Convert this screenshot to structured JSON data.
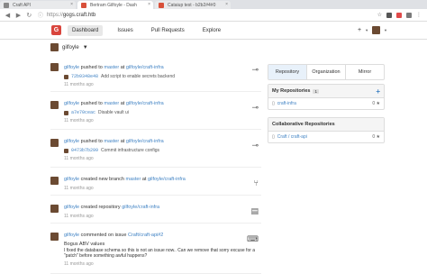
{
  "browser": {
    "tabs": [
      {
        "label": "Craft API",
        "active": false,
        "fav": "gray"
      },
      {
        "label": "Bertram Gilfoyle - Dash",
        "active": true,
        "fav": "red"
      },
      {
        "label": "Cataiup test - b2b2#4#0",
        "active": false,
        "fav": "red"
      }
    ],
    "url_prefix": "https://",
    "url_domain": "gogs.craft.htb"
  },
  "header": {
    "logo": "G",
    "menu": [
      "Dashboard",
      "Issues",
      "Pull Requests",
      "Explore"
    ],
    "active_menu": 0,
    "plus": "+"
  },
  "context_user": "gilfoyle",
  "feed": [
    {
      "user": "gilfoyle",
      "action": "pushed to",
      "target": "master",
      "prep": "at",
      "repo": "gilfoyle/craft-infra",
      "sha": "72b9348e48",
      "msg": "Add script to enable secrets backend",
      "time": "11 months ago",
      "icon": "commit"
    },
    {
      "user": "gilfoyle",
      "action": "pushed to",
      "target": "master",
      "prep": "at",
      "repo": "gilfoyle/craft-infra",
      "sha": "a7e70ceac",
      "msg": "Disable vault ui",
      "time": "11 months ago",
      "icon": "commit"
    },
    {
      "user": "gilfoyle",
      "action": "pushed to",
      "target": "master",
      "prep": "at",
      "repo": "gilfoyle/craft-infra",
      "sha": "0473b7b299",
      "msg": "Commit infrastructure configs",
      "time": "11 months ago",
      "icon": "commit"
    },
    {
      "user": "gilfoyle",
      "action": "created new branch",
      "target": "master",
      "prep": "at",
      "repo": "gilfoyle/craft-infra",
      "time": "11 months ago",
      "icon": "branch"
    },
    {
      "user": "gilfoyle",
      "action": "created repository",
      "target": "",
      "prep": "",
      "repo": "gilfoyle/craft-infra",
      "time": "11 months ago",
      "icon": "book"
    },
    {
      "user": "gilfoyle",
      "action": "commented on issue",
      "target": "",
      "prep": "",
      "repo": "Craft/craft-api#2",
      "issue_title": "Bogus ABV values",
      "issue_text": "I fixed the database schema so this is not an issue now.. Can we remove that sorry excuse for a \"patch\" before something awful happens?",
      "time": "11 months ago",
      "icon": "comment"
    }
  ],
  "sidebar": {
    "tabs": [
      "Repository",
      "Organization",
      "Mirror"
    ],
    "active_tab": 0,
    "my_repos": {
      "title": "My Repositories",
      "count": "1",
      "items": [
        {
          "name": "craft-infra",
          "stars": "0"
        }
      ]
    },
    "collab_repos": {
      "title": "Collaborative Repositories",
      "items": [
        {
          "name": "Craft / craft-api",
          "stars": "0"
        }
      ]
    }
  },
  "colors": {
    "accent": "#4183c4",
    "brand": "#d9453d"
  }
}
